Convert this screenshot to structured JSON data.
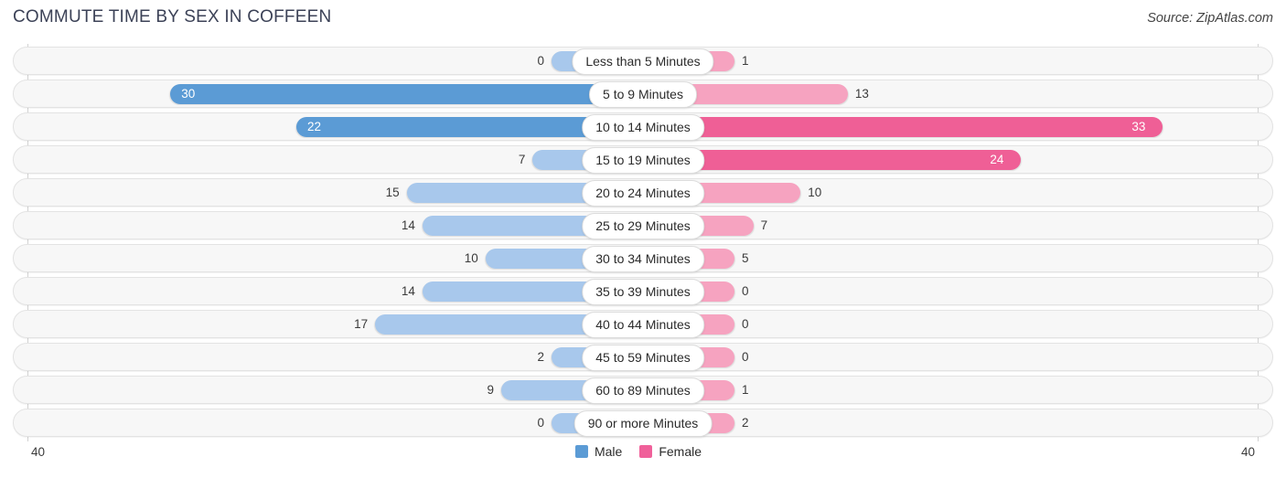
{
  "header": {
    "title": "COMMUTE TIME BY SEX IN COFFEEN",
    "source": "Source: ZipAtlas.com"
  },
  "legend": {
    "male_label": "Male",
    "female_label": "Female",
    "male_color": "#5b9bd5",
    "female_color": "#f0609a"
  },
  "axis": {
    "left_max_label": "40",
    "right_max_label": "40",
    "max": 40
  },
  "colors": {
    "male_strong": "#5b9bd5",
    "male_light": "#a8c8ec",
    "female_strong": "#ef5f96",
    "female_light": "#f6a3c0",
    "track_bg": "#f7f7f7",
    "track_border": "#e3e3e3"
  },
  "chart_data": {
    "type": "bar",
    "title": "COMMUTE TIME BY SEX IN COFFEEN",
    "xlabel": "",
    "ylabel": "",
    "orientation": "horizontal-diverging",
    "xlim": [
      -40,
      40
    ],
    "grid": false,
    "legend_position": "bottom-center",
    "categories": [
      "Less than 5 Minutes",
      "5 to 9 Minutes",
      "10 to 14 Minutes",
      "15 to 19 Minutes",
      "20 to 24 Minutes",
      "25 to 29 Minutes",
      "30 to 34 Minutes",
      "35 to 39 Minutes",
      "40 to 44 Minutes",
      "45 to 59 Minutes",
      "60 to 89 Minutes",
      "90 or more Minutes"
    ],
    "series": [
      {
        "name": "Male",
        "values": [
          0,
          30,
          22,
          7,
          15,
          14,
          10,
          14,
          17,
          2,
          9,
          0
        ]
      },
      {
        "name": "Female",
        "values": [
          1,
          13,
          33,
          24,
          10,
          7,
          5,
          0,
          0,
          0,
          1,
          2
        ]
      }
    ]
  },
  "rows": [
    {
      "label": "Less than 5 Minutes",
      "male": 0,
      "female": 1,
      "male_text": "0",
      "female_text": "1"
    },
    {
      "label": "5 to 9 Minutes",
      "male": 30,
      "female": 13,
      "male_text": "30",
      "female_text": "13"
    },
    {
      "label": "10 to 14 Minutes",
      "male": 22,
      "female": 33,
      "male_text": "22",
      "female_text": "33"
    },
    {
      "label": "15 to 19 Minutes",
      "male": 7,
      "female": 24,
      "male_text": "7",
      "female_text": "24"
    },
    {
      "label": "20 to 24 Minutes",
      "male": 15,
      "female": 10,
      "male_text": "15",
      "female_text": "10"
    },
    {
      "label": "25 to 29 Minutes",
      "male": 14,
      "female": 7,
      "male_text": "14",
      "female_text": "7"
    },
    {
      "label": "30 to 34 Minutes",
      "male": 10,
      "female": 5,
      "male_text": "10",
      "female_text": "5"
    },
    {
      "label": "35 to 39 Minutes",
      "male": 14,
      "female": 0,
      "male_text": "14",
      "female_text": "0"
    },
    {
      "label": "40 to 44 Minutes",
      "male": 17,
      "female": 0,
      "male_text": "17",
      "female_text": "0"
    },
    {
      "label": "45 to 59 Minutes",
      "male": 2,
      "female": 0,
      "male_text": "2",
      "female_text": "0"
    },
    {
      "label": "60 to 89 Minutes",
      "male": 9,
      "female": 1,
      "male_text": "9",
      "female_text": "1"
    },
    {
      "label": "90 or more Minutes",
      "male": 0,
      "female": 2,
      "male_text": "0",
      "female_text": "2"
    }
  ]
}
